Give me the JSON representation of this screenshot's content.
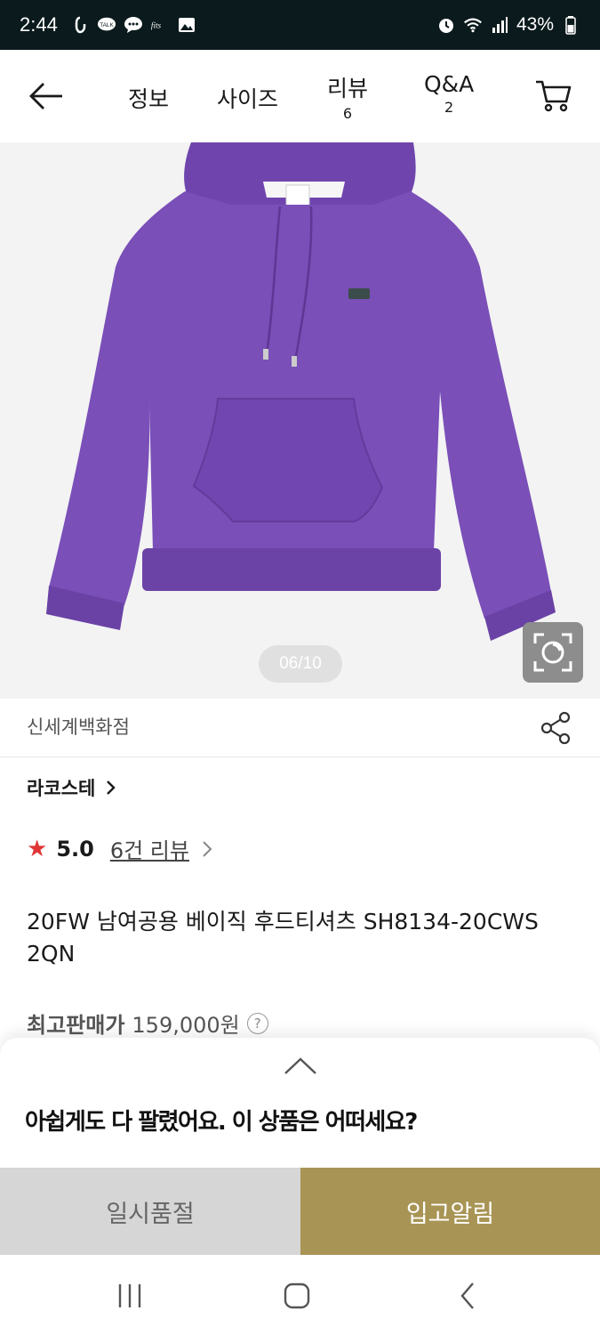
{
  "status_bar": {
    "time": "2:44",
    "battery": "43%",
    "icons_left": [
      "hand-notification-icon",
      "talk-icon",
      "chat-icon",
      "app-icon",
      "gallery-icon"
    ],
    "icons_right": [
      "alarm-icon",
      "wifi-icon",
      "signal-icon",
      "battery-icon"
    ]
  },
  "nav": {
    "tabs": [
      {
        "label": "정보"
      },
      {
        "label": "사이즈"
      },
      {
        "label": "리뷰",
        "count": "6"
      },
      {
        "label": "Q&A",
        "count": "2"
      }
    ]
  },
  "gallery": {
    "indicator": "06/10",
    "current": 6,
    "total": 10,
    "product_color": "#7a4fb8"
  },
  "store": {
    "name": "신세계백화점"
  },
  "brand": {
    "name": "라코스테"
  },
  "rating": {
    "score": "5.0",
    "reviews_label": "6건 리뷰"
  },
  "product": {
    "title": "20FW 남여공용 베이직 후드티셔츠 SH8134-20CWS 2QN"
  },
  "price": {
    "label": "최고판매가",
    "value": "159,000원",
    "help": "?"
  },
  "sheet": {
    "title": "아쉽게도 다 팔렸어요. 이 상품은 어떠세요?"
  },
  "actions": {
    "soldout": "일시품절",
    "notify": "입고알림"
  },
  "colors": {
    "accent": "#a89455",
    "disabled": "#d6d6d6",
    "star": "#e03434"
  }
}
